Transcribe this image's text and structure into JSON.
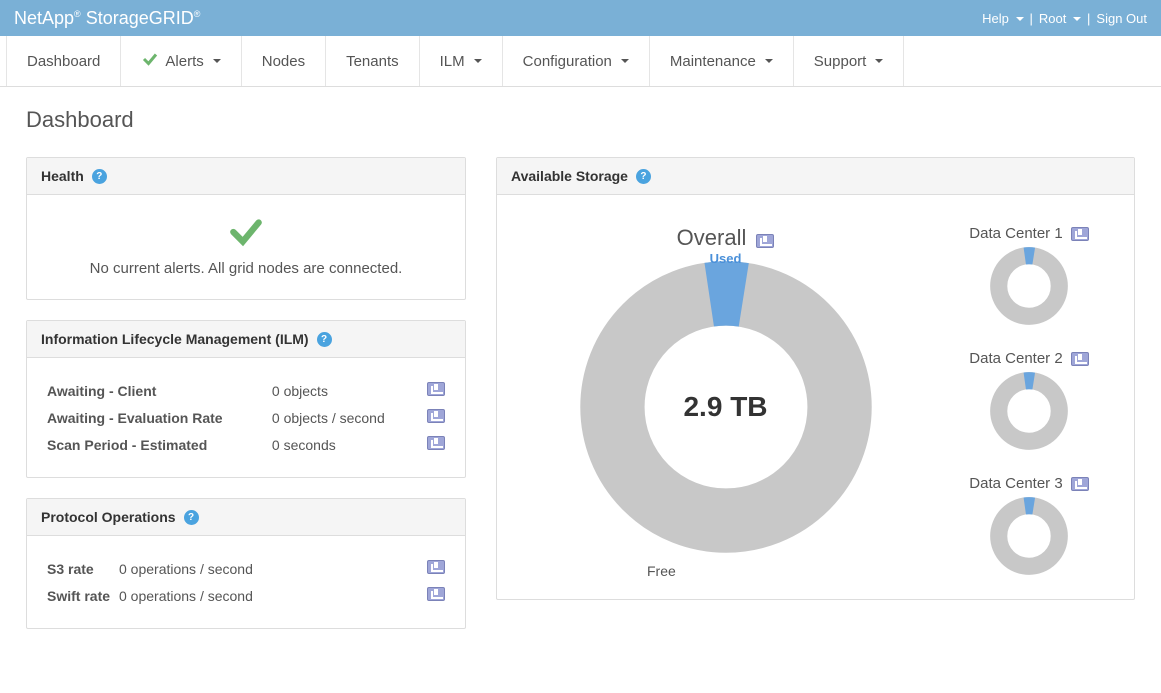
{
  "brand": {
    "company": "NetApp",
    "product": "StorageGRID"
  },
  "toplinks": {
    "help": "Help",
    "user": "Root",
    "signout": "Sign Out"
  },
  "nav": {
    "dashboard": "Dashboard",
    "alerts": "Alerts",
    "nodes": "Nodes",
    "tenants": "Tenants",
    "ilm": "ILM",
    "configuration": "Configuration",
    "maintenance": "Maintenance",
    "support": "Support"
  },
  "page": {
    "title": "Dashboard"
  },
  "health": {
    "title": "Health",
    "message": "No current alerts. All grid nodes are connected."
  },
  "ilm": {
    "title": "Information Lifecycle Management (ILM)",
    "rows": [
      {
        "label": "Awaiting - Client",
        "value": "0 objects"
      },
      {
        "label": "Awaiting - Evaluation Rate",
        "value": "0 objects / second"
      },
      {
        "label": "Scan Period - Estimated",
        "value": "0 seconds"
      }
    ]
  },
  "protocol": {
    "title": "Protocol Operations",
    "rows": [
      {
        "label": "S3 rate",
        "value": "0 operations / second"
      },
      {
        "label": "Swift rate",
        "value": "0 operations / second"
      }
    ]
  },
  "storage": {
    "title": "Available Storage",
    "overall_label": "Overall",
    "used_label": "Used",
    "free_label": "Free",
    "center_value": "2.9 TB",
    "datacenters": [
      {
        "name": "Data Center 1"
      },
      {
        "name": "Data Center 2"
      },
      {
        "name": "Data Center 3"
      }
    ]
  },
  "chart_data": [
    {
      "type": "pie",
      "title": "Overall",
      "categories": [
        "Used",
        "Free"
      ],
      "values": [
        5,
        95
      ],
      "center_label": "2.9 TB"
    },
    {
      "type": "pie",
      "title": "Data Center 1",
      "categories": [
        "Used",
        "Free"
      ],
      "values": [
        5,
        95
      ]
    },
    {
      "type": "pie",
      "title": "Data Center 2",
      "categories": [
        "Used",
        "Free"
      ],
      "values": [
        5,
        95
      ]
    },
    {
      "type": "pie",
      "title": "Data Center 3",
      "categories": [
        "Used",
        "Free"
      ],
      "values": [
        5,
        95
      ]
    }
  ]
}
